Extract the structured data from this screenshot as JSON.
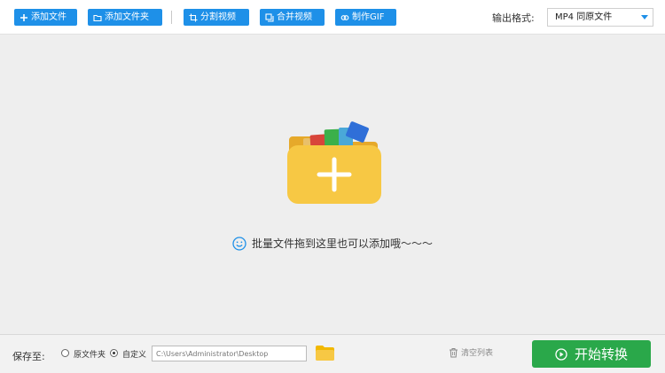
{
  "toolbar": {
    "add_file": "添加文件",
    "add_folder": "添加文件夹",
    "split_video": "分割视频",
    "merge_video": "合并视频",
    "make_gif": "制作GIF",
    "output_format_label": "输出格式:",
    "output_format_value": "MP4  同原文件"
  },
  "drop_zone": {
    "hint": "批量文件拖到这里也可以添加哦～～～"
  },
  "bottom": {
    "save_to_label": "保存至:",
    "radio_original": "原文件夹",
    "radio_custom": "自定义",
    "selected_option": "custom",
    "path_value": "C:\\Users\\Administrator\\Desktop",
    "clear_list": "清空列表",
    "start_convert": "开始转换"
  },
  "colors": {
    "toolbar_button": "#1e90e8",
    "start_button": "#2aa84a",
    "folder": "#f7c844"
  }
}
